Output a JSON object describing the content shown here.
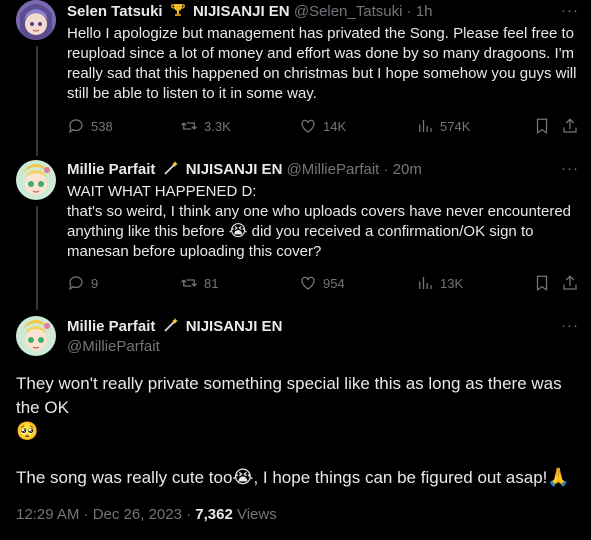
{
  "tweets": [
    {
      "name": "Selen Tatsuki",
      "badge_icon": "trophy-icon",
      "affiliation": "NIJISANJI EN",
      "handle": "@Selen_Tatsuki",
      "time": "· 1h",
      "text": "Hello I apologize but management has privated the Song. Please feel free to reupload since a lot of money and effort was done by so many dragoons. I'm really sad that this happened on christmas but I hope somehow you guys will still be able to listen to it in some way.",
      "replies": "538",
      "reposts": "3.3K",
      "likes": "14K",
      "views": "574K"
    },
    {
      "name": "Millie Parfait",
      "badge_icon": "magic-wand-icon",
      "affiliation": "NIJISANJI EN",
      "handle": "@MillieParfait",
      "time": "· 20m",
      "line1": "WAIT WHAT HAPPENED D:",
      "line2a": "that's so weird, I think any one who uploads covers have never encountered anything like this before ",
      "line2b": " did you received a confirmation/OK sign to manesan before uploading this cover?",
      "replies": "9",
      "reposts": "81",
      "likes": "954",
      "views": "13K"
    }
  ],
  "focus": {
    "name": "Millie Parfait",
    "badge_icon": "magic-wand-icon",
    "affiliation": "NIJISANJI EN",
    "handle": "@MillieParfait",
    "para1": "They won't really private something special like this as long as there was the OK",
    "para2a": "The song was really cute too",
    "para2b": ", I hope things can be figured out asap!",
    "timestamp": "12:29 AM · Dec 26, 2023 · ",
    "view_count": "7,362",
    "views_label": " Views"
  },
  "more_label": "···"
}
